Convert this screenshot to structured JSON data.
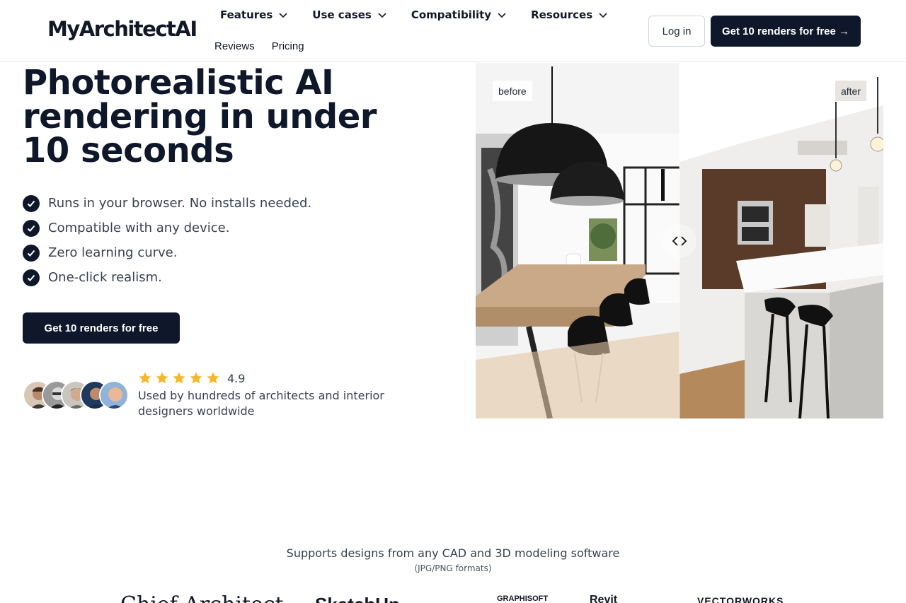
{
  "header": {
    "logo": "MyArchitectAI",
    "nav_top": [
      "Features",
      "Use cases",
      "Compatibility",
      "Resources"
    ],
    "nav_bottom": [
      "Reviews",
      "Pricing"
    ],
    "login_label": "Log in",
    "cta_label": "Get 10 renders for free →"
  },
  "hero": {
    "title_lines": [
      "Photorealistic AI",
      "rendering in under",
      "10 seconds"
    ],
    "features": [
      "Runs in your browser. No installs needed.",
      "Compatible with any device.",
      "Zero learning curve.",
      "One-click realism."
    ],
    "cta_label": "Get 10 renders for free",
    "rating_value": "4.9",
    "star_count": 5,
    "used_by": "Used by hundreds of architects and interior designers worldwide"
  },
  "compare": {
    "before_label": "before",
    "after_label": "after"
  },
  "supports": {
    "text": "Supports designs from any CAD and 3D modeling software",
    "formats": "(JPG/PNG formats)",
    "logos": [
      "Chief Architect",
      "SketchUp",
      "GRAPHISOFT",
      "Revit",
      "VECTORWORKS"
    ]
  },
  "colors": {
    "primary": "#0f172a",
    "star": "#f5b82e",
    "border": "#e5e7eb"
  }
}
